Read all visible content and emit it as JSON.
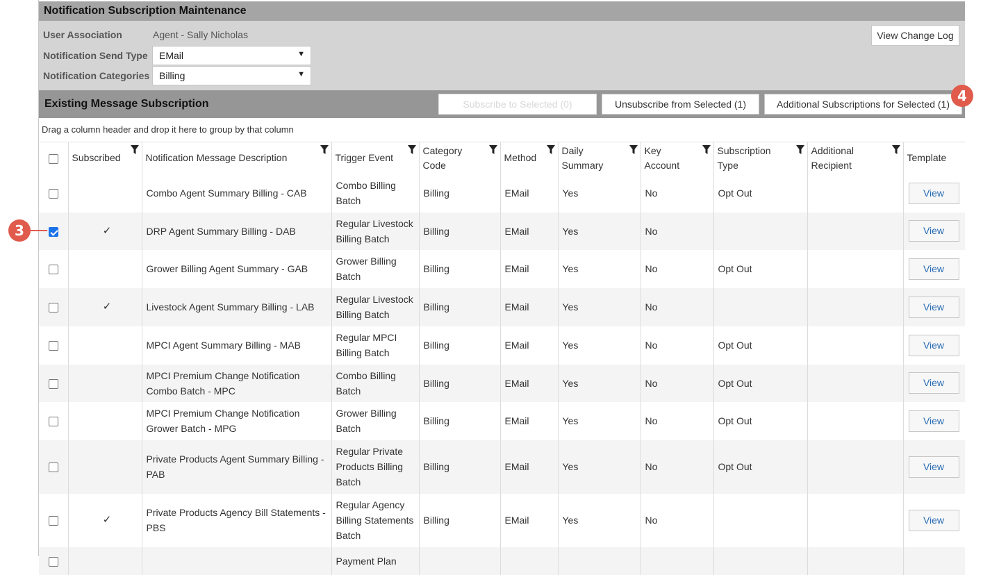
{
  "window": {
    "title": "Notification Subscription Maintenance"
  },
  "filters": {
    "user_association_label": "User Association",
    "user_association_value": "Agent - Sally Nicholas",
    "send_type_label": "Notification Send Type",
    "send_type_value": "EMail",
    "categories_label": "Notification Categories",
    "categories_value": "Billing"
  },
  "toolbar": {
    "view_change_log": "View Change Log",
    "subscribe_selected": "Subscribe to Selected (0)",
    "unsubscribe_selected": "Unsubscribe from Selected (1)",
    "additional_subscriptions": "Additional Subscriptions for Selected (1)"
  },
  "section": {
    "title": "Existing Message Subscription",
    "group_hint": "Drag a column header and drop it here to group by that column"
  },
  "callouts": {
    "three": "3",
    "four": "4"
  },
  "table": {
    "headers": {
      "subscribed": "Subscribed",
      "description": "Notification Message Description",
      "trigger": "Trigger Event",
      "category": "Category Code",
      "method": "Method",
      "daily": "Daily Summary",
      "key": "Key Account",
      "subtype": "Subscription Type",
      "additional": "Additional Recipient",
      "template": "Template"
    },
    "rows": [
      {
        "selected": false,
        "subscribed": "",
        "description": "Combo Agent Summary Billing - CAB",
        "trigger": "Combo Billing Batch",
        "category": "Billing",
        "method": "EMail",
        "daily": "Yes",
        "key": "No",
        "subtype": "Opt Out",
        "additional": "",
        "template": "View"
      },
      {
        "selected": true,
        "subscribed": "✓",
        "description": "DRP Agent Summary Billing - DAB",
        "trigger": "Regular Livestock Billing Batch",
        "category": "Billing",
        "method": "EMail",
        "daily": "Yes",
        "key": "No",
        "subtype": "",
        "additional": "",
        "template": "View"
      },
      {
        "selected": false,
        "subscribed": "",
        "description": "Grower Billing Agent Summary - GAB",
        "trigger": "Grower Billing Batch",
        "category": "Billing",
        "method": "EMail",
        "daily": "Yes",
        "key": "No",
        "subtype": "Opt Out",
        "additional": "",
        "template": "View"
      },
      {
        "selected": false,
        "subscribed": "✓",
        "description": "Livestock Agent Summary Billing - LAB",
        "trigger": "Regular Livestock Billing Batch",
        "category": "Billing",
        "method": "EMail",
        "daily": "Yes",
        "key": "No",
        "subtype": "",
        "additional": "",
        "template": "View"
      },
      {
        "selected": false,
        "subscribed": "",
        "description": "MPCI Agent Summary Billing - MAB",
        "trigger": "Regular MPCI Billing Batch",
        "category": "Billing",
        "method": "EMail",
        "daily": "Yes",
        "key": "No",
        "subtype": "Opt Out",
        "additional": "",
        "template": "View"
      },
      {
        "selected": false,
        "subscribed": "",
        "description": "MPCI Premium Change Notification Combo Batch - MPC",
        "trigger": "Combo Billing Batch",
        "category": "Billing",
        "method": "EMail",
        "daily": "Yes",
        "key": "No",
        "subtype": "Opt Out",
        "additional": "",
        "template": "View"
      },
      {
        "selected": false,
        "subscribed": "",
        "description": "MPCI Premium Change Notification Grower Batch - MPG",
        "trigger": "Grower Billing Batch",
        "category": "Billing",
        "method": "EMail",
        "daily": "Yes",
        "key": "No",
        "subtype": "Opt Out",
        "additional": "",
        "template": "View"
      },
      {
        "selected": false,
        "subscribed": "",
        "description": "Private Products Agent Summary Billing - PAB",
        "trigger": "Regular Private Products Billing Batch",
        "category": "Billing",
        "method": "EMail",
        "daily": "Yes",
        "key": "No",
        "subtype": "Opt Out",
        "additional": "",
        "template": "View"
      },
      {
        "selected": false,
        "subscribed": "✓",
        "description": "Private Products Agency Bill Statements - PBS",
        "trigger": "Regular Agency Billing Statements Batch",
        "category": "Billing",
        "method": "EMail",
        "daily": "Yes",
        "key": "No",
        "subtype": "",
        "additional": "",
        "template": "View"
      },
      {
        "selected": false,
        "subscribed": "",
        "description": "",
        "trigger": "Payment Plan",
        "category": "",
        "method": "",
        "daily": "",
        "key": "",
        "subtype": "",
        "additional": "",
        "template": ""
      }
    ]
  }
}
